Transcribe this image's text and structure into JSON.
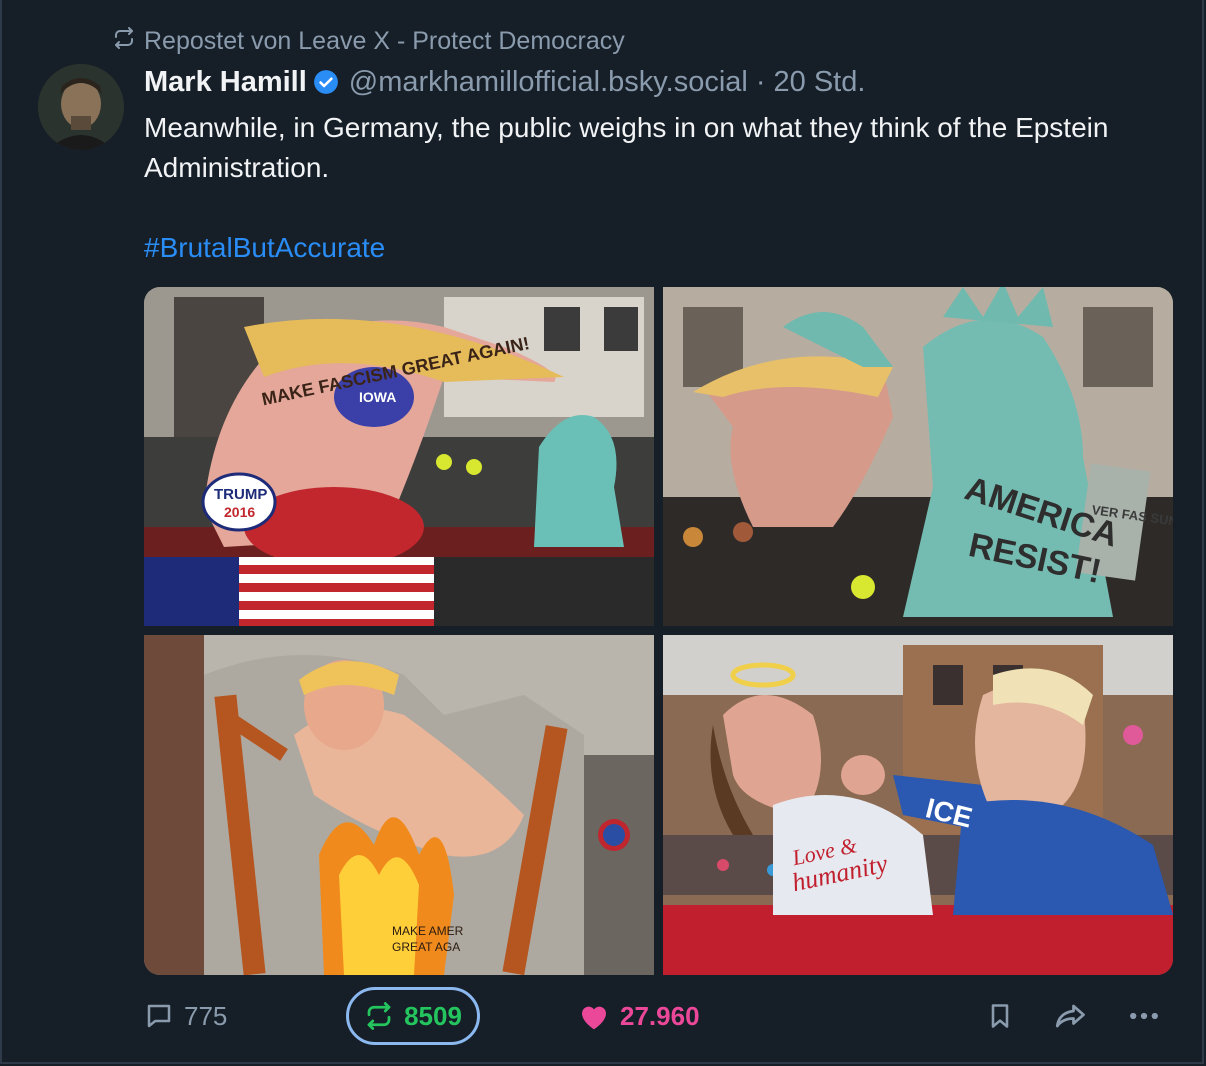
{
  "repost": {
    "label": "Repostet von Leave X - Protect Democracy"
  },
  "author": {
    "name": "Mark Hamill",
    "handle": "@markhamillofficial.bsky.social",
    "separator": "·",
    "time": "20 Std."
  },
  "post": {
    "text": "Meanwhile, in Germany, the public weighs in on what they think of the Epstein Administration.",
    "hashtag": "#BrutalButAccurate"
  },
  "images": {
    "img1": {
      "banner": "MAKE FASCISM GREAT AGAIN!",
      "iowa": "IOWA",
      "trump": "TRUMP",
      "year": "2016"
    },
    "img2": {
      "line1": "AMERICA",
      "line2": "RESIST!",
      "sign": "VER FAS SUNG"
    },
    "img3": {
      "line1": "MAKE AMER",
      "line2": "GREAT AGA"
    },
    "img4": {
      "love": "Love &",
      "humanity": "humanity",
      "ice": "ICE"
    }
  },
  "actions": {
    "replies": "775",
    "reposts": "8509",
    "likes": "27.960"
  },
  "colors": {
    "background": "#161e27",
    "accent": "#2a8cf5",
    "repost": "#24c55e",
    "like": "#ec4899",
    "muted": "#8a9bad"
  }
}
